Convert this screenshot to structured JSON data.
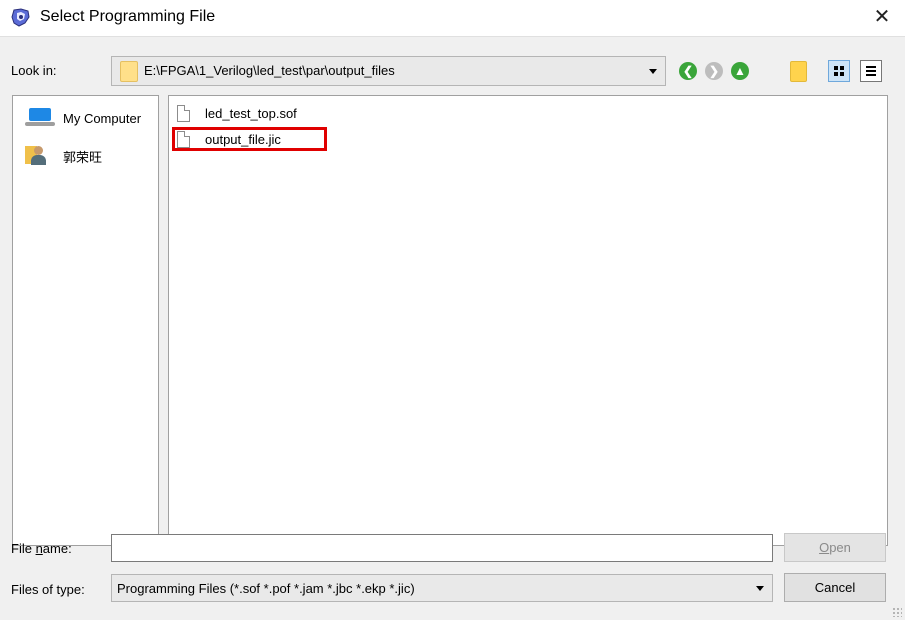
{
  "window": {
    "title": "Select Programming File",
    "close_glyph": "✕"
  },
  "look_in": {
    "label": "Look in:",
    "path": "E:\\FPGA\\1_Verilog\\led_test\\par\\output_files"
  },
  "toolbar": {
    "back_glyph": "❮",
    "forward_glyph": "❯",
    "up_glyph": "▲"
  },
  "sidebar": {
    "items": [
      {
        "label": "My Computer",
        "icon": "computer-icon"
      },
      {
        "label": "郭荣旺",
        "icon": "user-folder-icon"
      }
    ]
  },
  "files": [
    {
      "name": "led_test_top.sof",
      "icon": "file-icon",
      "highlighted": false
    },
    {
      "name": "output_file.jic",
      "icon": "file-icon",
      "highlighted": true
    }
  ],
  "file_name": {
    "label_pre": "File ",
    "label_underlined": "n",
    "label_post": "ame:",
    "value": ""
  },
  "file_type": {
    "label": "Files of type:",
    "selected": "Programming Files (*.sof *.pof *.jam *.jbc *.ekp *.jic)"
  },
  "buttons": {
    "open_pre": "",
    "open_underlined": "O",
    "open_post": "pen",
    "cancel": "Cancel"
  },
  "colors": {
    "highlight": "#e00000",
    "accent_green": "#3aa53a",
    "disabled_text": "#8a8a8a"
  }
}
